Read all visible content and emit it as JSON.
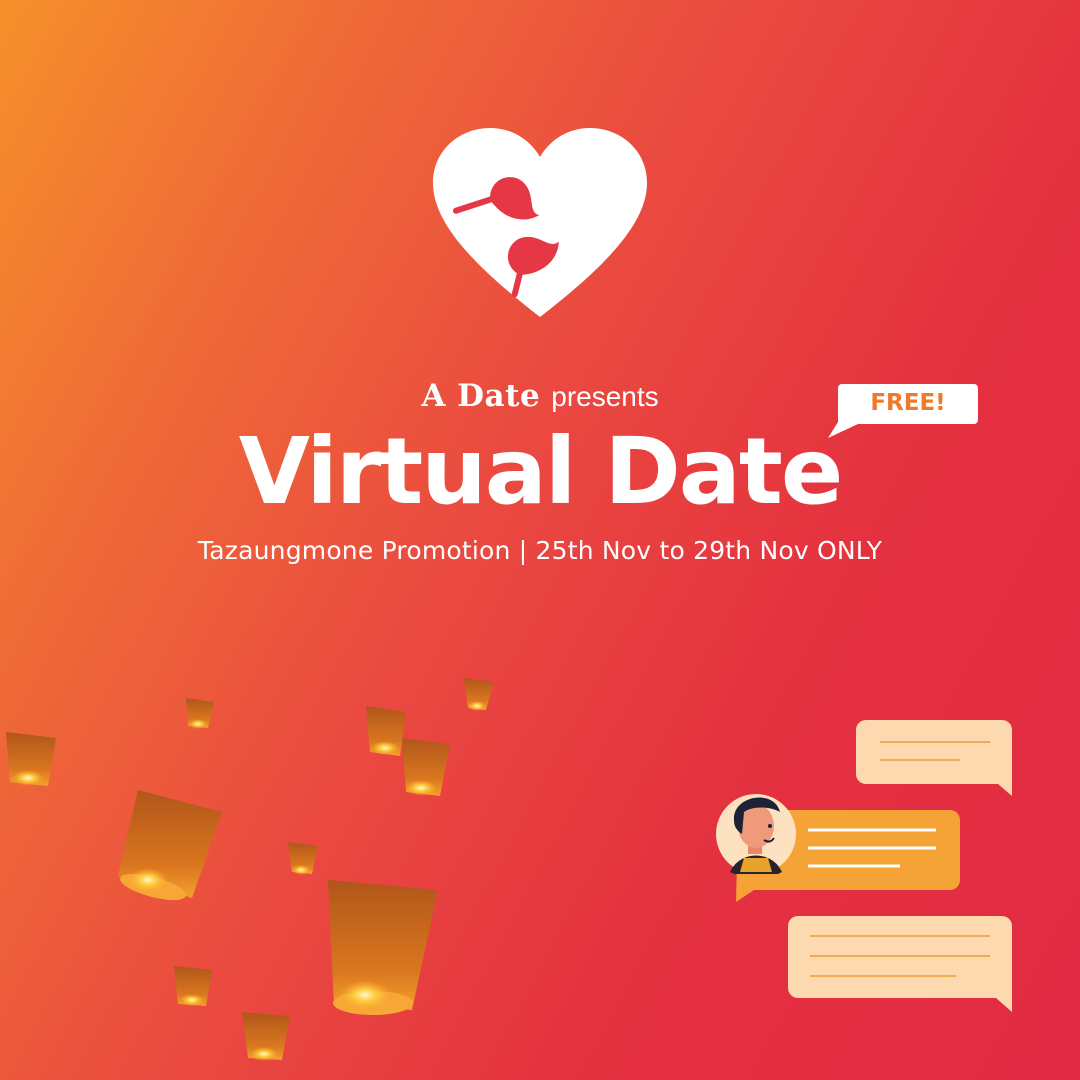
{
  "brand": {
    "name": "A Date",
    "presents": "presents"
  },
  "badge": {
    "label": "FREE!"
  },
  "title": "Virtual Date",
  "subtitle": "Tazaungmone Promotion | 25th Nov to 29th Nov ONLY",
  "icons": [
    "heart-logo-icon",
    "sky-lantern-icon",
    "chat-bubble-icon",
    "avatar"
  ],
  "colors": {
    "bg_orange": "#f6902a",
    "bg_red": "#e22a44",
    "heart": "#ffffff",
    "leaf": "#e63746",
    "badge_text": "#ef7a2a",
    "bubble_light": "#fdd9b0",
    "bubble_orange": "#f5a236"
  }
}
